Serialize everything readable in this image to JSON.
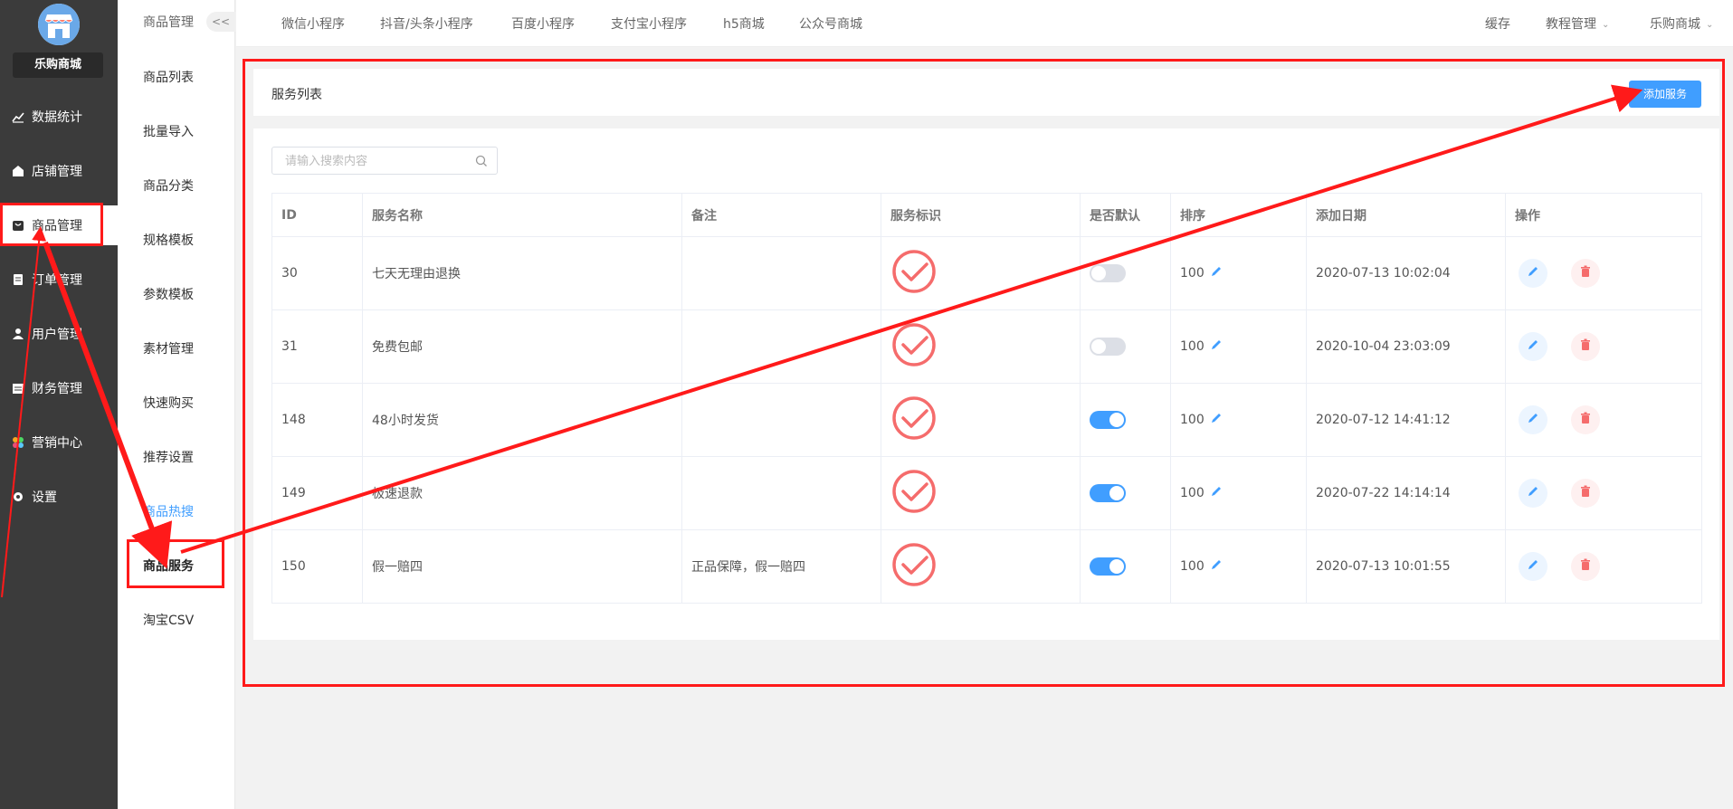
{
  "app": {
    "name": "乐购商城"
  },
  "sidebar": {
    "items": [
      {
        "label": "数据统计",
        "icon": "chart-icon"
      },
      {
        "label": "店铺管理",
        "icon": "store-icon"
      },
      {
        "label": "商品管理",
        "icon": "goods-icon",
        "active": true
      },
      {
        "label": "订单管理",
        "icon": "order-icon"
      },
      {
        "label": "用户管理",
        "icon": "user-icon"
      },
      {
        "label": "财务管理",
        "icon": "finance-icon"
      },
      {
        "label": "营销中心",
        "icon": "marketing-icon"
      },
      {
        "label": "设置",
        "icon": "gear-icon"
      }
    ]
  },
  "subnav": {
    "title": "商品管理",
    "collapse_label": "<<",
    "items": [
      {
        "label": "商品列表"
      },
      {
        "label": "批量导入"
      },
      {
        "label": "商品分类"
      },
      {
        "label": "规格模板"
      },
      {
        "label": "参数模板"
      },
      {
        "label": "素材管理"
      },
      {
        "label": "快速购买"
      },
      {
        "label": "推荐设置"
      },
      {
        "label": "商品热搜"
      },
      {
        "label": "商品服务"
      },
      {
        "label": "淘宝CSV"
      }
    ]
  },
  "topnav": {
    "tabs": [
      "微信小程序",
      "抖音/头条小程序",
      "百度小程序",
      "支付宝小程序",
      "h5商城",
      "公众号商城"
    ],
    "right": [
      "缓存",
      "教程管理",
      "乐购商城"
    ]
  },
  "page": {
    "title": "服务列表",
    "add_button": "添加服务",
    "search_placeholder": "请输入搜索内容"
  },
  "table": {
    "columns": [
      "ID",
      "服务名称",
      "备注",
      "服务标识",
      "是否默认",
      "排序",
      "添加日期",
      "操作"
    ],
    "rows": [
      {
        "id": "30",
        "name": "七天无理由退换",
        "remark": "",
        "default": false,
        "sort": "100",
        "date": "2020-07-13 10:02:04"
      },
      {
        "id": "31",
        "name": "免费包邮",
        "remark": "",
        "default": false,
        "sort": "100",
        "date": "2020-10-04 23:03:09"
      },
      {
        "id": "148",
        "name": "48小时发货",
        "remark": "",
        "default": true,
        "sort": "100",
        "date": "2020-07-12 14:41:12"
      },
      {
        "id": "149",
        "name": "极速退款",
        "remark": "",
        "default": true,
        "sort": "100",
        "date": "2020-07-22 14:14:14"
      },
      {
        "id": "150",
        "name": "假一赔四",
        "remark": "正品保障，假一赔四",
        "default": true,
        "sort": "100",
        "date": "2020-07-13 10:01:55"
      }
    ]
  },
  "colors": {
    "accent": "#409eff",
    "sidebar": "#3b3b3b",
    "annotation": "#ff1a1a",
    "check": "#f56c6c",
    "danger": "#f56c6c"
  }
}
